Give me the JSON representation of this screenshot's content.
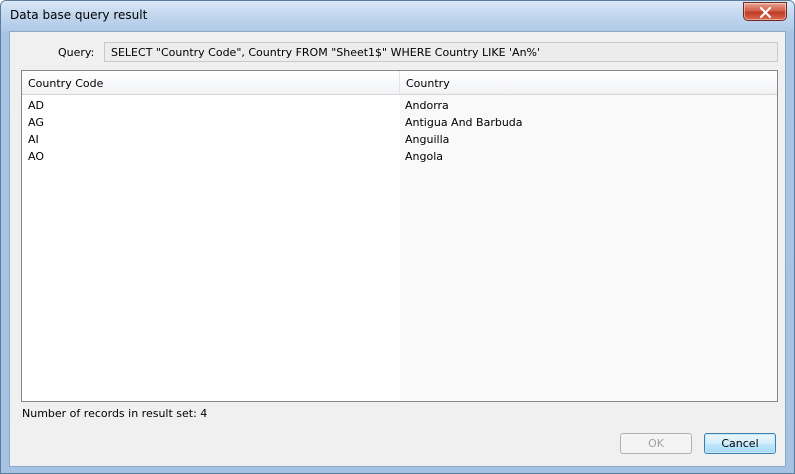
{
  "window": {
    "title": "Data base query result",
    "close_icon": "close-x-icon"
  },
  "query": {
    "label": "Query:",
    "text": "SELECT \"Country Code\", Country FROM \"Sheet1$\" WHERE Country LIKE 'An%'"
  },
  "grid": {
    "columns": [
      "Country Code",
      "Country"
    ],
    "rows": [
      [
        "AD",
        "Andorra"
      ],
      [
        "AG",
        "Antigua And Barbuda"
      ],
      [
        "AI",
        "Anguilla"
      ],
      [
        "AO",
        "Angola"
      ]
    ]
  },
  "status": {
    "text": "Number of records in result set: 4"
  },
  "buttons": {
    "ok_label": "OK",
    "ok_enabled": false,
    "cancel_label": "Cancel"
  },
  "colors": {
    "titlebar": "#c3d7ef",
    "close_button": "#c13d25",
    "cancel_border": "#3c7fb1"
  }
}
